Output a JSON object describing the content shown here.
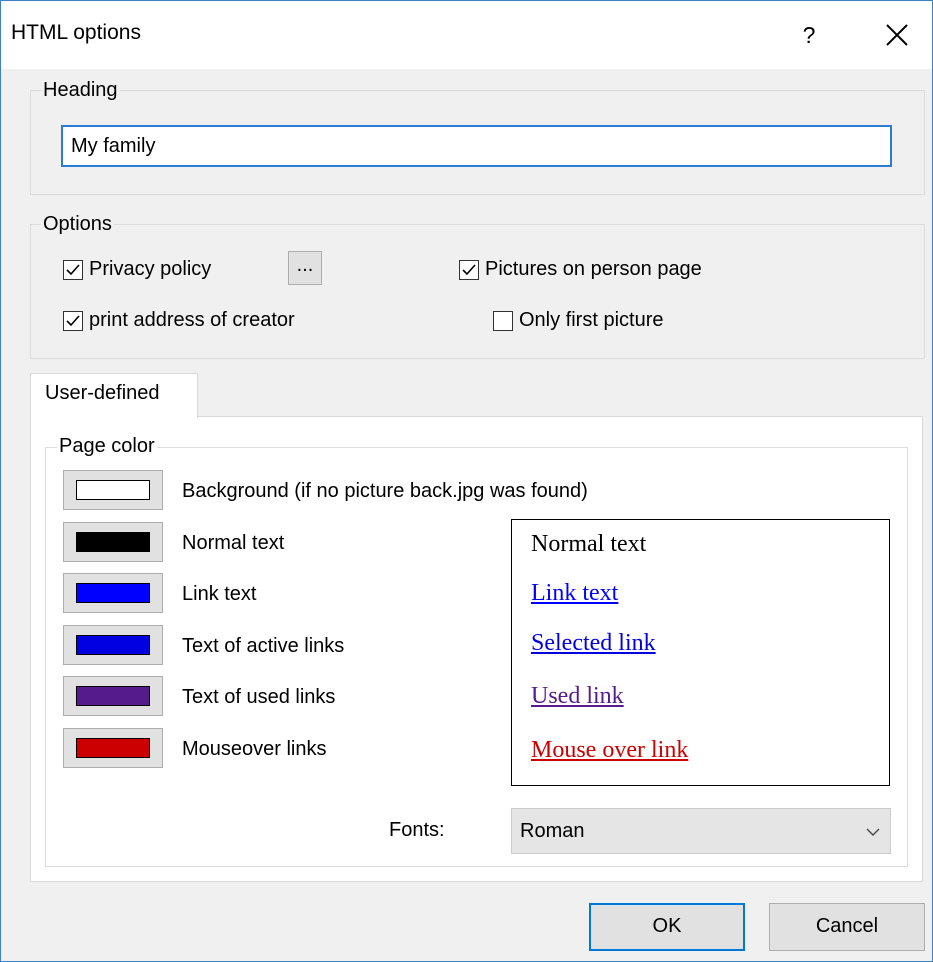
{
  "window": {
    "title": "HTML options",
    "help_label": "?"
  },
  "heading_group": {
    "label": "Heading",
    "value": "My family"
  },
  "options_group": {
    "label": "Options",
    "privacy_policy": {
      "label": "Privacy policy",
      "checked": true
    },
    "privacy_button_label": "...",
    "print_address": {
      "label": "print address of creator",
      "checked": true
    },
    "pictures_on_person_page": {
      "label": "Pictures on person page",
      "checked": true
    },
    "only_first_picture": {
      "label": "Only first picture",
      "checked": false
    }
  },
  "tabs": [
    {
      "label": "User-defined",
      "active": true
    }
  ],
  "page_color": {
    "label": "Page color",
    "items": [
      {
        "label": "Background (if no picture back.jpg was found)",
        "color": "#ffffff"
      },
      {
        "label": "Normal text",
        "color": "#000000"
      },
      {
        "label": "Link text",
        "color": "#0000ff"
      },
      {
        "label": "Text of active links",
        "color": "#0000e0"
      },
      {
        "label": "Text of used links",
        "color": "#551a8b"
      },
      {
        "label": "Mouseover links",
        "color": "#cc0000"
      }
    ]
  },
  "preview": {
    "normal": "Normal text",
    "link": "Link text",
    "selected": "Selected link",
    "used": "Used link",
    "mouseover": "Mouse over link"
  },
  "fonts": {
    "label": "Fonts:",
    "value": "Roman"
  },
  "buttons": {
    "ok": "OK",
    "cancel": "Cancel"
  }
}
